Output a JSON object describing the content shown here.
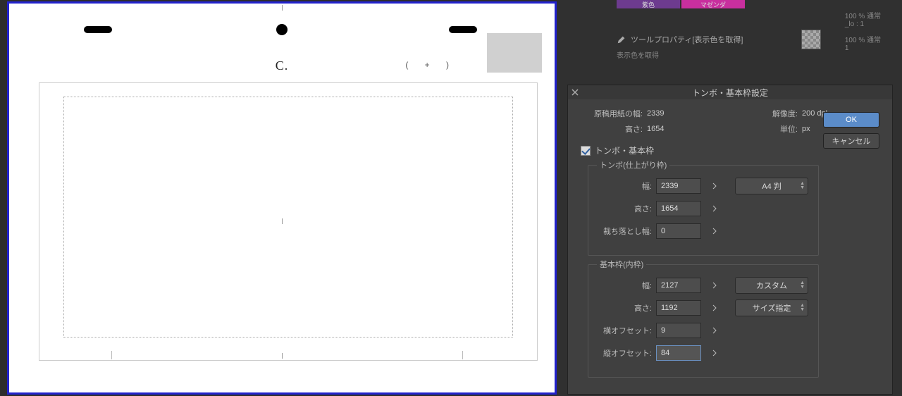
{
  "canvas": {
    "field_letter": "C.",
    "parens_plus": "( + )"
  },
  "palette": {
    "purple": "紫色",
    "magenta": "マゼンダ",
    "tool_property_label": "ツールプロパティ[表示色を取得]",
    "tool_sub": "表示色を取得",
    "layer1": "100 % 通常",
    "layer1_name": "_lo : 1",
    "layer2": "100 % 通常",
    "layer2_name": "1"
  },
  "dialog": {
    "title": "トンボ・基本枠設定",
    "ok": "OK",
    "cancel": "キャンセル",
    "readout": {
      "paper_width_label": "原稿用紙の幅:",
      "paper_width": "2339",
      "height_label": "高さ:",
      "height": "1654",
      "resolution_label": "解像度:",
      "resolution": "200 dpi",
      "unit_label": "単位:",
      "unit": "px"
    },
    "checkbox_label": "トンボ・基本枠",
    "trim_group": {
      "legend": "トンボ(仕上がり枠)",
      "width_label": "幅:",
      "width": "2339",
      "height_label": "高さ:",
      "height": "1654",
      "bleed_label": "裁ち落とし幅:",
      "bleed": "0",
      "preset": "A4 判"
    },
    "inner_group": {
      "legend": "基本枠(内枠)",
      "width_label": "幅:",
      "width": "2127",
      "height_label": "高さ:",
      "height": "1192",
      "xoff_label": "横オフセット:",
      "xoff": "9",
      "yoff_label": "縦オフセット:",
      "yoff": "84",
      "preset_custom": "カスタム",
      "preset_size": "サイズ指定"
    }
  }
}
